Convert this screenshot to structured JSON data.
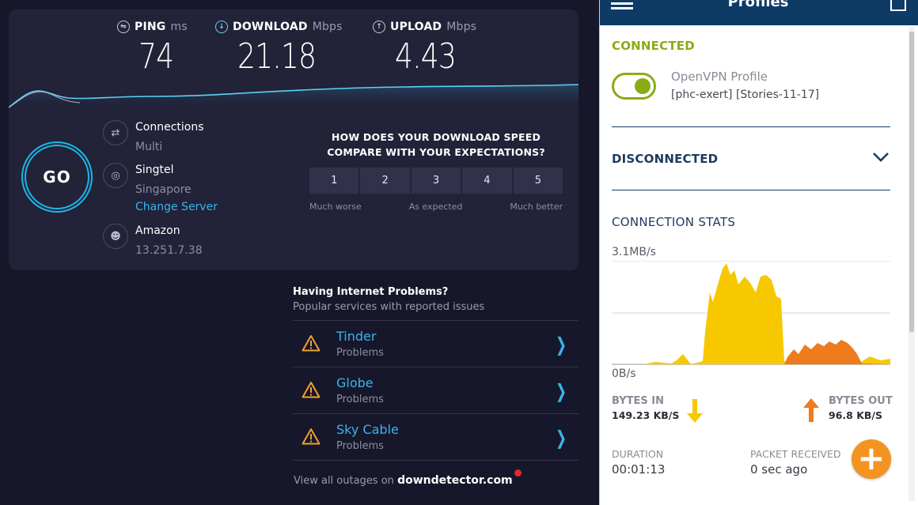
{
  "speedtest": {
    "ping": {
      "label": "PING",
      "unit": "ms",
      "value": "74"
    },
    "download": {
      "label": "DOWNLOAD",
      "unit": "Mbps",
      "value": "21.18"
    },
    "upload": {
      "label": "UPLOAD",
      "unit": "Mbps",
      "value": "4.43"
    },
    "go_label": "GO",
    "connections": {
      "title": "Connections",
      "value": "Multi"
    },
    "isp": {
      "title": "Singtel",
      "location": "Singapore",
      "change_link": "Change Server"
    },
    "host": {
      "title": "Amazon",
      "ip": "13.251.7.38"
    },
    "compare": {
      "question": "HOW DOES YOUR DOWNLOAD SPEED COMPARE WITH YOUR EXPECTATIONS?",
      "ratings": [
        "1",
        "2",
        "3",
        "4",
        "5"
      ],
      "low_label": "Much worse",
      "mid_label": "As expected",
      "high_label": "Much better"
    },
    "problems": {
      "title": "Having Internet Problems?",
      "subtitle": "Popular services with reported issues",
      "items": [
        {
          "name": "Tinder",
          "status": "Problems"
        },
        {
          "name": "Globe",
          "status": "Problems"
        },
        {
          "name": "Sky Cable",
          "status": "Problems"
        }
      ],
      "outages_text": "View all outages on",
      "outages_brand": "downdetector.com"
    },
    "colors": {
      "accent": "#3ab4ee",
      "warning": "#f0a030",
      "panel": "#222238"
    }
  },
  "vpn": {
    "title": "Profiles",
    "status_connected": "CONNECTED",
    "profile_name": "OpenVPN Profile",
    "profile_detail": "[phc-exert] [Stories-11-17]",
    "disconnected_label": "DISCONNECTED",
    "stats_title": "CONNECTION STATS",
    "chart_max_label": "3.1MB/s",
    "chart_min_label": "0B/s",
    "bytes_in": {
      "label": "BYTES IN",
      "value": "149.23 KB/S"
    },
    "bytes_out": {
      "label": "BYTES OUT",
      "value": "96.8 KB/S"
    },
    "duration": {
      "label": "DURATION",
      "value": "00:01:13"
    },
    "packet_received": {
      "label": "PACKET RECEIVED",
      "value": "0 sec ago"
    },
    "colors": {
      "bar": "#0e3a66",
      "connected": "#8aab15",
      "in": "#f7c800",
      "out": "#ee7b1d",
      "fab": "#f39421"
    }
  }
}
